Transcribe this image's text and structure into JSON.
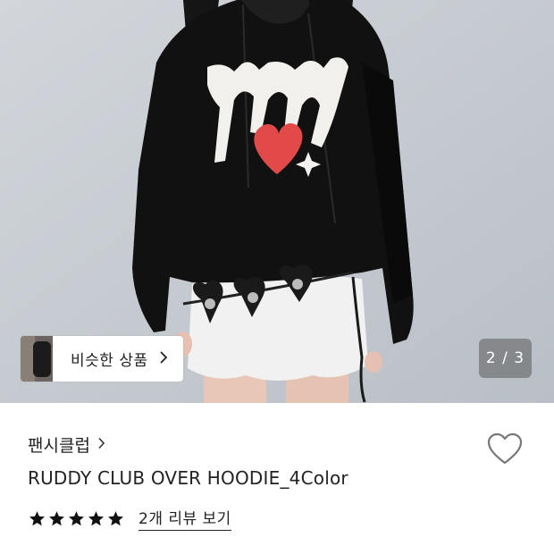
{
  "gallery": {
    "similar_button_label": "비슷한 상품",
    "similar_chevron": "›",
    "page_counter": "2 / 3"
  },
  "product": {
    "brand": "팬시클럽",
    "brand_chevron": "›",
    "title": "RUDDY CLUB OVER HOODIE_4Color",
    "rating_stars": 5,
    "review_link_label": "2개 리뷰 보기"
  },
  "colors": {
    "star": "#111111",
    "heart_outline": "#777777",
    "counter_bg": "#5a5a5a",
    "hoodie_print_heart": "#e24a4a"
  },
  "icons": [
    "chevron-right-icon",
    "heart-outline-icon",
    "star-icon"
  ]
}
